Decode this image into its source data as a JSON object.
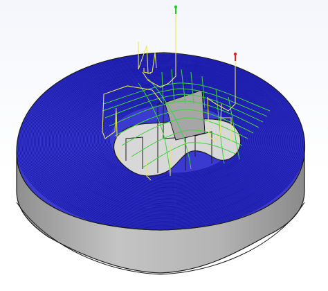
{
  "viewport": {
    "background": "#ffffff",
    "colors": {
      "stock_side": "#bcbcbc",
      "stock_side_dark": "#9a9a9a",
      "stock_outline": "#1a1a1a",
      "roughing_toolpath": "#1a1aa8",
      "finishing_toolpath": "#3fd23f",
      "rapid_moves": "#e8e85a",
      "tool_marker_green": "#22cc22",
      "tool_marker_red": "#e02020"
    },
    "icons": [
      "tool-marker-green-icon",
      "tool-marker-red-icon"
    ]
  }
}
